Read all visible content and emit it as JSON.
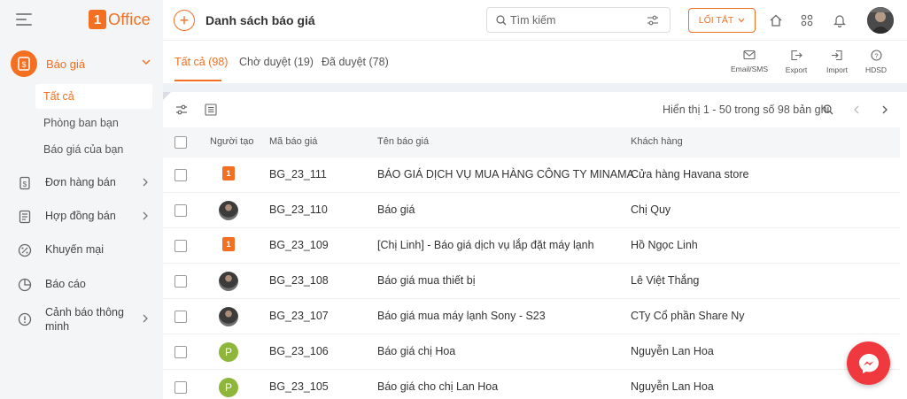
{
  "brand": {
    "logo_letter": "1",
    "logo_text": "Office",
    "accent": "#f36f21"
  },
  "sidebar": {
    "main": {
      "label": "Báo giá",
      "icon": "quote-doc-icon"
    },
    "subitems": [
      {
        "label": "Tất cả",
        "active": true
      },
      {
        "label": "Phòng ban bạn",
        "active": false
      },
      {
        "label": "Báo giá của bạn",
        "active": false
      }
    ],
    "items": [
      {
        "label": "Đơn hàng bán",
        "icon": "order-icon",
        "has_children": true
      },
      {
        "label": "Hợp đồng bán",
        "icon": "contract-icon",
        "has_children": true
      },
      {
        "label": "Khuyến mại",
        "icon": "discount-icon",
        "has_children": false
      },
      {
        "label": "Báo cáo",
        "icon": "report-icon",
        "has_children": false
      },
      {
        "label": "Cảnh báo thông minh",
        "icon": "alert-icon",
        "has_children": true
      }
    ]
  },
  "header": {
    "title": "Danh sách báo giá",
    "search_placeholder": "Tìm kiếm",
    "shortcut_label": "LỐI TẮT"
  },
  "tabs": [
    {
      "label": "Tất cả (98)",
      "active": true
    },
    {
      "label": "Chờ duyệt (19)",
      "active": false
    },
    {
      "label": "Đã duyệt (78)",
      "active": false
    }
  ],
  "tools": [
    {
      "label": "Email/SMS",
      "icon": "mail-icon"
    },
    {
      "label": "Export",
      "icon": "export-icon"
    },
    {
      "label": "Import",
      "icon": "import-icon"
    },
    {
      "label": "HDSD",
      "icon": "help-icon"
    }
  ],
  "pager": {
    "text": "Hiển thị 1 - 50 trong số 98 bản ghi"
  },
  "table": {
    "columns": [
      "Người tạo",
      "Mã báo giá",
      "Tên báo giá",
      "Khách hàng"
    ],
    "rows": [
      {
        "creator": "logo",
        "creator_letter": "1",
        "code": "BG_23_111",
        "name": "BÁO GIÁ DỊCH VỤ MUA HÀNG CÔNG TY MINAMA",
        "customer": "Cửa hàng Havana store"
      },
      {
        "creator": "photo",
        "creator_letter": "",
        "code": "BG_23_110",
        "name": "Báo giá",
        "customer": "Chị Quy"
      },
      {
        "creator": "logo",
        "creator_letter": "1",
        "code": "BG_23_109",
        "name": "[Chị Linh] - Báo giá dịch vụ lắp đặt máy lạnh",
        "customer": "Hồ Ngọc Linh"
      },
      {
        "creator": "photo",
        "creator_letter": "",
        "code": "BG_23_108",
        "name": "Báo giá mua thiết bị",
        "customer": "Lê Việt Thắng"
      },
      {
        "creator": "photo",
        "creator_letter": "",
        "code": "BG_23_107",
        "name": "Báo giá mua máy lạnh Sony - S23",
        "customer": "CTy Cổ phần Share Ny"
      },
      {
        "creator": "letter",
        "creator_letter": "P",
        "code": "BG_23_106",
        "name": "Báo giá chị Hoa",
        "customer": "Nguyễn Lan Hoa"
      },
      {
        "creator": "letter",
        "creator_letter": "P",
        "code": "BG_23_105",
        "name": "Báo giá cho chị Lan Hoa",
        "customer": "Nguyễn Lan Hoa"
      }
    ]
  }
}
